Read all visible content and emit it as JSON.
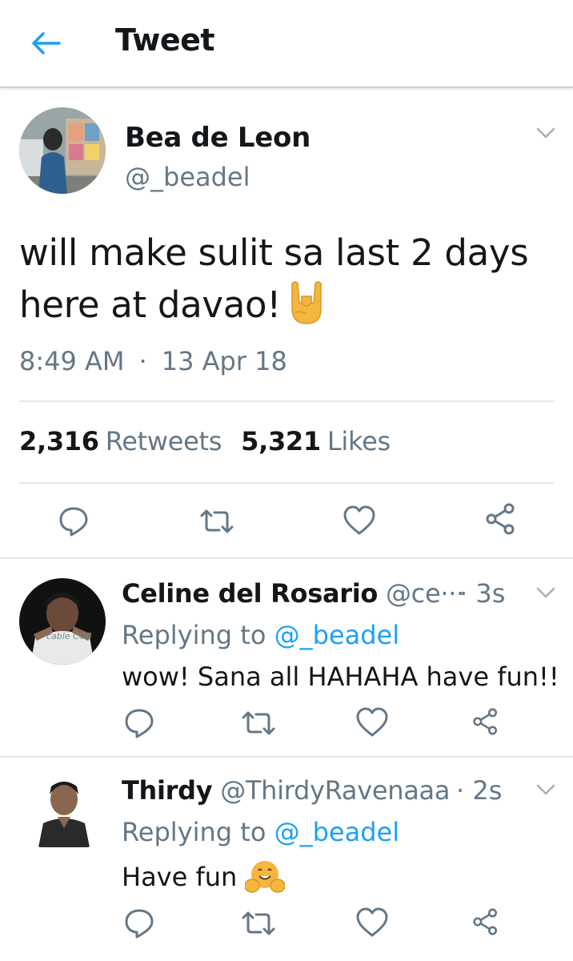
{
  "header": {
    "title": "Tweet"
  },
  "tweet": {
    "author_name": "Bea de Leon",
    "author_handle": "@_beadel",
    "text_line1": "will make sulit sa last 2 days",
    "text_line2": "here at davao!",
    "emoji": "rock-on-hand-emoji",
    "time": "8:49 AM",
    "separator": "·",
    "date": "13 Apr 18",
    "retweet_count": "2,316",
    "retweet_label": "Retweets",
    "like_count": "5,321",
    "like_label": "Likes"
  },
  "replies": [
    {
      "author_name": "Celine del Rosario",
      "author_handle": "@ce···",
      "separator": "·",
      "time": "3s",
      "replying_prefix": "Replying to",
      "replying_mention": "@_beadel",
      "text": "wow! Sana all HAHAHA have fun!!",
      "avatar_text": "cable COB"
    },
    {
      "author_name": "Thirdy",
      "author_handle": "@ThirdyRavenaaa",
      "separator": "·",
      "time": "2s",
      "replying_prefix": "Replying to",
      "replying_mention": "@_beadel",
      "text": "Have fun",
      "emoji": "hugging-face-emoji"
    }
  ],
  "icons": {
    "back": "back-arrow-icon",
    "caret": "chevron-down-icon",
    "reply": "reply-icon",
    "retweet": "retweet-icon",
    "like": "heart-icon",
    "share": "share-icon"
  },
  "colors": {
    "accent": "#1da1f2",
    "secondary_text": "#657786",
    "primary_text": "#14171a",
    "divider": "#e1e8ed",
    "emoji_yellow": "#f4b63f"
  }
}
